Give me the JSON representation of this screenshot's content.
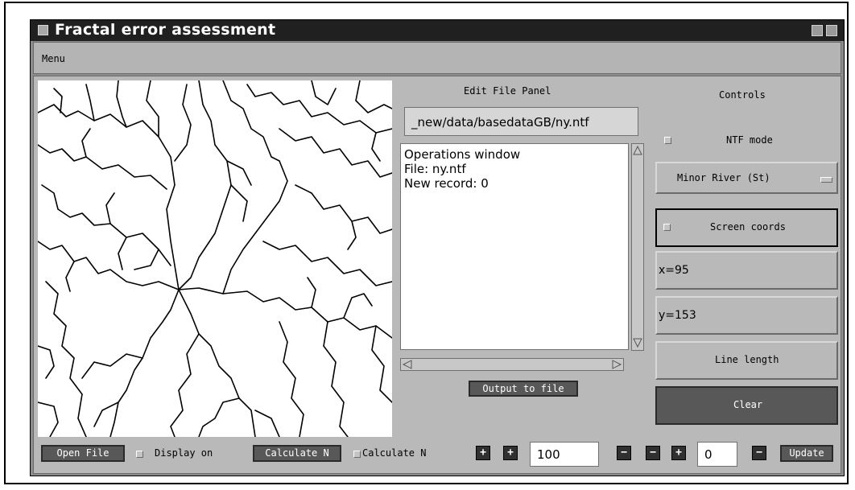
{
  "window": {
    "title": "Fractal error assessment"
  },
  "menubar": {
    "menu_label": "Menu"
  },
  "edit_panel": {
    "heading": "Edit File Panel",
    "file_path": "_new/data/basedataGB/ny.ntf",
    "operations_lines": [
      "Operations window",
      "File: ny.ntf",
      "New record: 0"
    ],
    "output_button": "Output to file"
  },
  "controls": {
    "heading": "Controls",
    "ntf_mode_label": "NTF mode",
    "feature_select_value": "Minor River (St)",
    "screen_coords_label": "Screen coords",
    "x_readout": "x=95",
    "y_readout": "y=153",
    "line_length_button": "Line length",
    "clear_button": "Clear"
  },
  "bottom_bar": {
    "open_file_button": "Open File",
    "display_on_label": "Display on",
    "calculate_n_button": "Calculate N",
    "calculate_n_check_label": "Calculate N",
    "value_field_1": "100",
    "value_field_2": "0",
    "update_button": "Update",
    "plus_symbol": "+",
    "minus_symbol": "−"
  },
  "colors": {
    "titlebar": "#202020",
    "panel": "#b9b9b9",
    "dark_button": "#585858"
  }
}
